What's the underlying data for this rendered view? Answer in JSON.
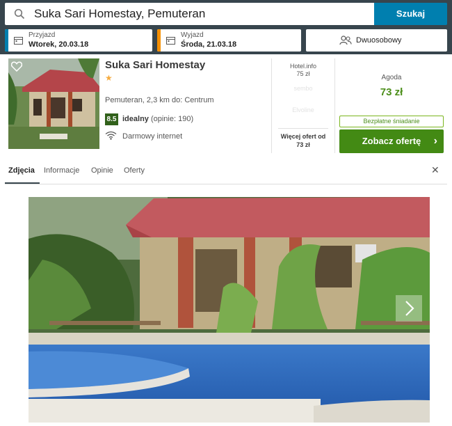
{
  "search": {
    "value": "Suka Sari Homestay, Pemuteran",
    "button_label": "Szukaj"
  },
  "checkin": {
    "label": "Przyjazd",
    "value": "Wtorek, 20.03.18"
  },
  "checkout": {
    "label": "Wyjazd",
    "value": "Środa, 21.03.18"
  },
  "room": {
    "label": "Dwuosobowy"
  },
  "hotel": {
    "name": "Suka Sari Homestay",
    "stars": "★",
    "location": "Pemuteran, 2,3 km do: Centrum",
    "rating_score": "8.5",
    "rating_word": "idealny",
    "rating_count": "(opinie: 190)",
    "amenity": "Darmowy internet"
  },
  "other_offers": {
    "main": {
      "provider": "Hotel.info",
      "price": "75 zł"
    },
    "blurred": [
      "sembo",
      "Elvoline"
    ],
    "more_label": "Więcej ofert od",
    "more_price": "73 zł"
  },
  "best_offer": {
    "provider": "Agoda",
    "price": "73 zł",
    "badge": "Bezpłatne śniadanie",
    "button_label": "Zobacz ofertę"
  },
  "tabs": [
    "Zdjęcia",
    "Informacje",
    "Opinie",
    "Oferty"
  ],
  "colors": {
    "topband": "#37454d",
    "search_button": "#007faf",
    "checkin_bar": "#007faf",
    "checkout_bar": "#f48f00",
    "deal_green": "#438a14",
    "rating_green": "#31611b"
  },
  "icons": [
    "search-icon",
    "calendar-icon",
    "people-icon",
    "heart-icon",
    "wifi-icon",
    "close-icon",
    "chevron-right-icon"
  ]
}
